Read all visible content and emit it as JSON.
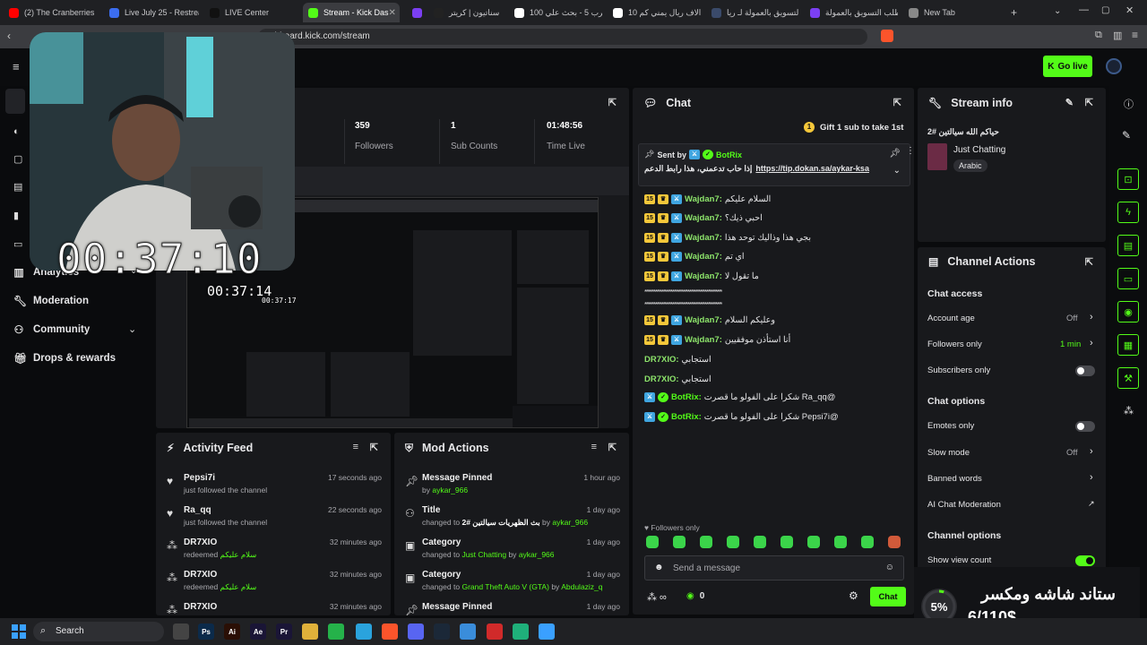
{
  "browser": {
    "tabs": [
      {
        "title": "(2) The Cranberries - 2",
        "color": "#ff0000"
      },
      {
        "title": "Live July 25 - Restream",
        "color": "#3b6df0"
      },
      {
        "title": "LIVE Center",
        "color": "#111111"
      },
      {
        "title": "Stream - Kick Das",
        "color": "#53fc18"
      },
      {
        "title": "",
        "color": "#7b3ff2"
      },
      {
        "title": "سناتيون | كريتر",
        "color": "#222222"
      },
      {
        "title": "100 ضرب 5 - بحث علي",
        "color": "#ffffff"
      },
      {
        "title": "10 الاف ريال يمني كم",
        "color": "#ffffff"
      },
      {
        "title": "التسويق بالعمولة لـ ريا",
        "color": "#3a4a6a"
      },
      {
        "title": "طلب التسويق بالعمولة",
        "color": "#7b3ff2"
      },
      {
        "title": "New Tab",
        "color": "#888888"
      }
    ],
    "url": "ashboard.kick.com/stream"
  },
  "header": {
    "go_live": "Go live"
  },
  "sidebar": {
    "items": [
      {
        "label": "Analytics",
        "icon": "bar-chart-icon"
      },
      {
        "label": "Moderation",
        "icon": "wrench-icon"
      },
      {
        "label": "Community",
        "icon": "people-icon"
      },
      {
        "label": "Drops & rewards",
        "icon": "gift-icon"
      }
    ]
  },
  "overlay": {
    "timer_large": "00:37:10",
    "timer_small": "00:37:14",
    "timer_tiny": "00:37:17",
    "donation_text": "ستاند شاشه ومكسر",
    "donation_amount": "6/110$",
    "donation_percent": "5%",
    "donation_fraction": 0.05
  },
  "stats": [
    {
      "value": "359",
      "label": "Followers"
    },
    {
      "value": "1",
      "label": "Sub Counts"
    },
    {
      "value": "01:48:56",
      "label": "Time Live"
    }
  ],
  "activity": {
    "title": "Activity Feed",
    "rows": [
      {
        "name": "Pepsi7i",
        "sub": "just followed the channel",
        "time": "17 seconds ago",
        "icon": "heart-icon"
      },
      {
        "name": "Ra_qq",
        "sub": "just followed the channel",
        "time": "22 seconds ago",
        "icon": "heart-icon"
      },
      {
        "name": "DR7XIO",
        "sub": "redeemed",
        "reward": "سلام عليكم",
        "time": "32 minutes ago",
        "icon": "points-icon"
      },
      {
        "name": "DR7XIO",
        "sub": "redeemed",
        "reward": "سلام عليكم",
        "time": "32 minutes ago",
        "icon": "points-icon"
      },
      {
        "name": "DR7XIO",
        "sub": "",
        "reward": "",
        "time": "32 minutes ago",
        "icon": "points-icon"
      }
    ]
  },
  "mod": {
    "title": "Mod Actions",
    "rows": [
      {
        "name": "Message Pinned",
        "pre": "by",
        "a": "aykar_966",
        "mid": "",
        "b": "",
        "time": "1 hour ago",
        "icon": "pin-icon"
      },
      {
        "name": "Title",
        "pre": "changed to",
        "a": "بث الظهريات سيالتين #2",
        "mid": "by",
        "b": "aykar_966",
        "time": "1 day ago",
        "icon": "title-icon"
      },
      {
        "name": "Category",
        "pre": "changed to",
        "a": "Just Chatting",
        "mid": "by",
        "b": "aykar_966",
        "time": "1 day ago",
        "icon": "category-icon"
      },
      {
        "name": "Category",
        "pre": "changed to",
        "a": "Grand Theft Auto V (GTA)",
        "mid": "by",
        "b": "Abdulaziz_q",
        "time": "1 day ago",
        "icon": "category-icon"
      },
      {
        "name": "Message Pinned",
        "pre": "",
        "a": "",
        "mid": "",
        "b": "",
        "time": "1 day ago",
        "icon": "pin-icon"
      }
    ]
  },
  "chat": {
    "title": "Chat",
    "gift": "Gift 1 sub to take 1st",
    "pinned": {
      "sent_by": "Sent by",
      "user": "BotRix",
      "text": "إذا حاب تدعمني، هذا رابط الدعم",
      "link": "https://tip.dokan.sa/aykar-ksa"
    },
    "messages": [
      {
        "user": "Wajdan7:",
        "text": "السلام عليكم",
        "badges": true,
        "bot": false
      },
      {
        "user": "Wajdan7:",
        "text": "احبي ذيك؟",
        "badges": true,
        "bot": false
      },
      {
        "user": "Wajdan7:",
        "text": "بجي هذا وذاليك توحد هذا",
        "badges": true,
        "bot": false
      },
      {
        "user": "Wajdan7:",
        "text": "اي تم",
        "badges": true,
        "bot": false
      },
      {
        "user": "Wajdan7:",
        "text": "ما تقول لا",
        "badges": true,
        "bot": false
      },
      {
        "user": "",
        "text": "**************************************************",
        "badges": false,
        "bot": false
      },
      {
        "user": "",
        "text": "**************************************************",
        "badges": false,
        "bot": false
      },
      {
        "user": "Wajdan7:",
        "text": "وعليكم السلام",
        "badges": true,
        "bot": false
      },
      {
        "user": "Wajdan7:",
        "text": "أنا استأذن موفقيين",
        "badges": true,
        "bot": false
      },
      {
        "user": "DR7XIO:",
        "text": "استجابي",
        "badges": false,
        "bot": false
      },
      {
        "user": "DR7XIO:",
        "text": "استجابي",
        "badges": false,
        "bot": false
      },
      {
        "user": "BotRix:",
        "text": "شكرا على الفولو ما قصرت Ra_qq@",
        "badges": false,
        "bot": true
      },
      {
        "user": "BotRix:",
        "text": "شكرا على الفولو ما قصرت Pepsi7i@",
        "badges": false,
        "bot": true
      }
    ],
    "followers_only": "Followers only",
    "placeholder": "Send a message",
    "points": "0",
    "send": "Chat"
  },
  "stream_info": {
    "title": "Stream info",
    "stream_title": "حياكم الله سيالتين #2",
    "category": "Just Chatting",
    "tag": "Arabic"
  },
  "channel_actions": {
    "title": "Channel Actions",
    "chat_access": "Chat access",
    "account_age": "Account age",
    "account_age_val": "Off",
    "followers_only": "Followers only",
    "followers_only_val": "1 min",
    "subscribers_only": "Subscribers only",
    "subscribers_only_on": false,
    "chat_options": "Chat options",
    "emotes_only": "Emotes only",
    "emotes_only_on": false,
    "slow_mode": "Slow mode",
    "slow_mode_val": "Off",
    "banned_words": "Banned words",
    "ai_moderation": "AI Chat Moderation",
    "channel_options": "Channel options",
    "show_view_count": "Show view count",
    "show_view_count_on": true
  },
  "taskbar": {
    "search": "Search"
  },
  "colors": {
    "accent": "#53fc18",
    "panel": "#18191c",
    "bg": "#0a0b0d"
  }
}
